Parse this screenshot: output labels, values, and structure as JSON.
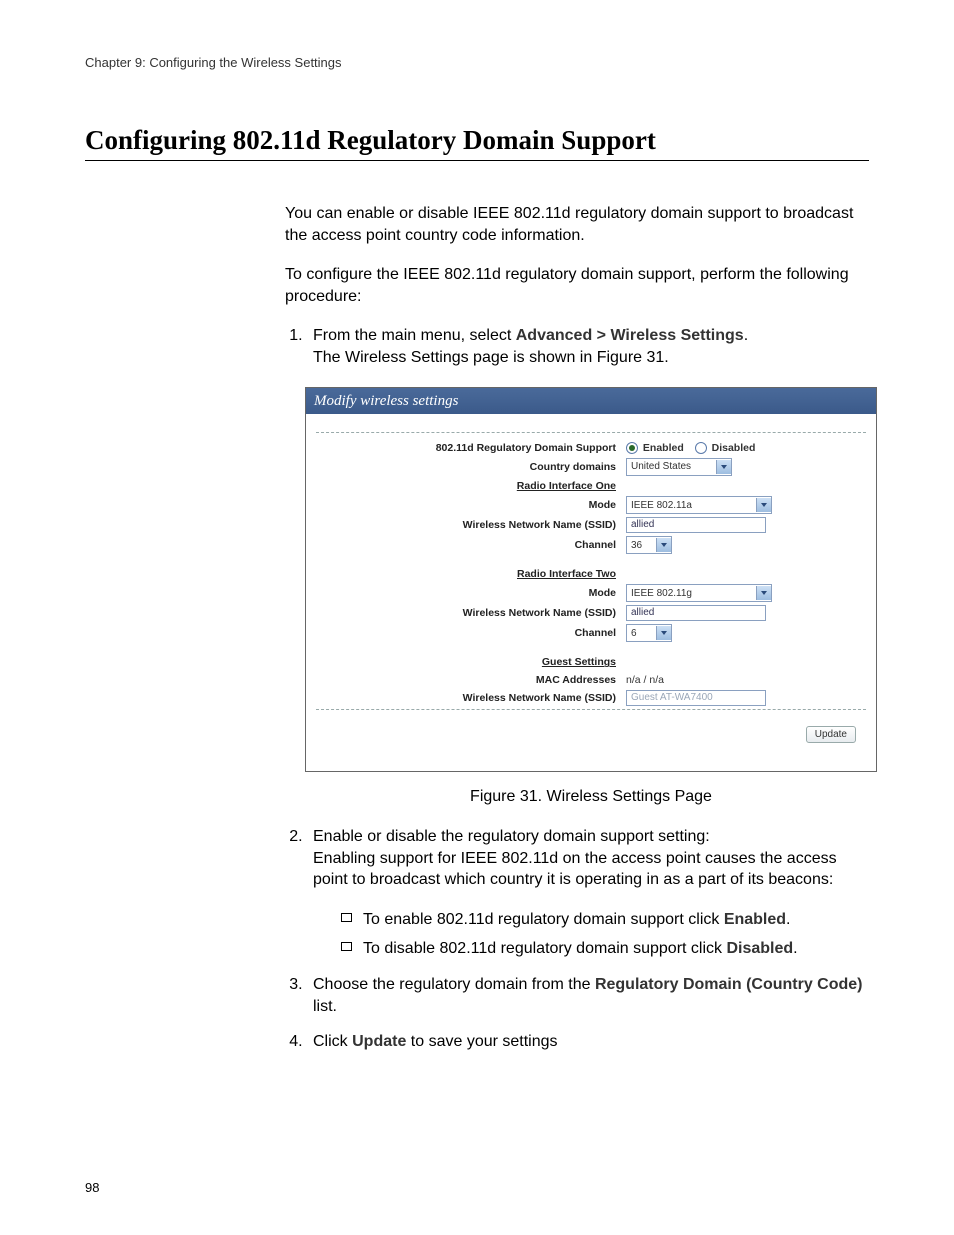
{
  "header": "Chapter 9: Configuring the Wireless Settings",
  "title": "Configuring 802.11d Regulatory Domain Support",
  "intro1": "You can enable or disable IEEE 802.11d regulatory domain support to broadcast the access point country code information.",
  "intro2": "To configure the IEEE 802.11d regulatory domain support, perform the following procedure:",
  "step1_a": "From the main menu, select ",
  "step1_b": "Advanced > Wireless Settings",
  "step1_c": ".",
  "step1_sub": "The Wireless Settings page is shown in Figure 31.",
  "fig": {
    "panel_title": "Modify wireless settings",
    "labels": {
      "reg": "802.11d Regulatory Domain Support",
      "country": "Country domains",
      "r1": "Radio Interface One",
      "mode": "Mode",
      "ssid": "Wireless Network Name (SSID)",
      "channel": "Channel",
      "r2": "Radio Interface Two",
      "guest": "Guest Settings",
      "mac": "MAC Addresses"
    },
    "values": {
      "enabled": "Enabled",
      "disabled": "Disabled",
      "country": "United States",
      "mode1": "IEEE 802.11a",
      "ssid1": "allied",
      "ch1": "36",
      "mode2": "IEEE 802.11g",
      "ssid2": "allied",
      "ch2": "6",
      "mac": "n/a / n/a",
      "gssid": "Guest AT-WA7400",
      "update": "Update"
    }
  },
  "caption": "Figure 31. Wireless Settings Page",
  "step2": "Enable or disable the regulatory domain support setting:",
  "step2_sub": "Enabling support for IEEE 802.11d on the access point causes the access point to broadcast which country it is operating in as a part of its beacons:",
  "bullet1_a": "To enable 802.11d regulatory domain support click ",
  "bullet1_b": "Enabled",
  "bullet2_a": "To disable 802.11d regulatory domain support click ",
  "bullet2_b": "Disabled",
  "step3_a": "Choose the regulatory domain from the ",
  "step3_b": "Regulatory Domain (Country Code)",
  "step3_c": " list.",
  "step4_a": "Click ",
  "step4_b": "Update",
  "step4_c": " to save your settings",
  "page_num": "98"
}
